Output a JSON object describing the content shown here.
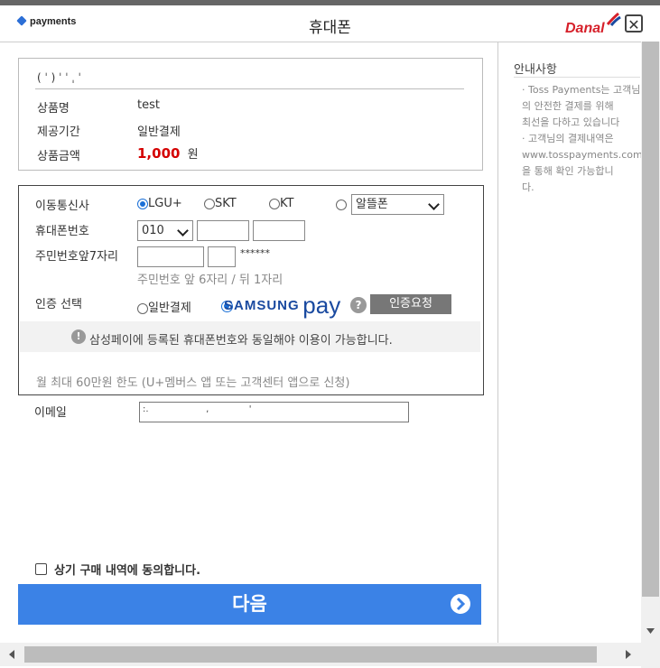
{
  "header": {
    "brand": "payments",
    "title": "휴대폰",
    "pg_logo": "Danal",
    "close_label": "✕"
  },
  "product": {
    "masked_line": "( ˈ ) ˈ ˈ ˌ ˈ ᅟ",
    "rows": [
      {
        "label": "상품명",
        "value": "test"
      },
      {
        "label": "제공기간",
        "value": "일반결제"
      },
      {
        "label": "상품금액",
        "price": "1,000",
        "unit": "원"
      }
    ]
  },
  "form": {
    "carrier_label": "이동통신사",
    "carriers": [
      "LGU+",
      "SKT",
      "KT"
    ],
    "mvno_select": "알뜰폰",
    "phone_label": "휴대폰번호",
    "phone_prefix": "010",
    "ssn_label": "주민번호앞7자리",
    "ssn_mask": "******",
    "ssn_hint": "주민번호 앞 6자리 / 뒤 1자리",
    "auth_label": "인증 선택",
    "auth_normal": "일반결제",
    "samsung_word": "SAMSUNG",
    "pay_word": "pay",
    "help_icon": "?",
    "verify_button": "인증요청",
    "notice_icon": "!",
    "notice_text": "삼성페이에 등록된 휴대폰번호와 동일해야 이용이 가능합니다.",
    "limit_text": "월 최대 60만원 한도 (U+멤버스 앱 또는 고객센터 앱으로 신청)"
  },
  "email": {
    "label": "이메일",
    "masked_value": ":.                    ,              '"
  },
  "agree_text": "상기 구매 내역에 동의합니다.",
  "next_button": "다음",
  "sidebar": {
    "title": "안내사항",
    "notes": [
      [
        "· Toss Payments는 고객님",
        "  의 안전한 결제를 위해",
        "  최선을 다하고 있습니다"
      ],
      [
        "· 고객님의 결제내역은",
        "  www.tosspayments.com",
        "  을 통해 확인 가능합니",
        "  다."
      ]
    ]
  },
  "colors": {
    "accent": "#3b82e6",
    "price": "#d40000",
    "radio": "#1a6fd6",
    "danal": "#d6202a",
    "samsung": "#1a4aa0"
  }
}
